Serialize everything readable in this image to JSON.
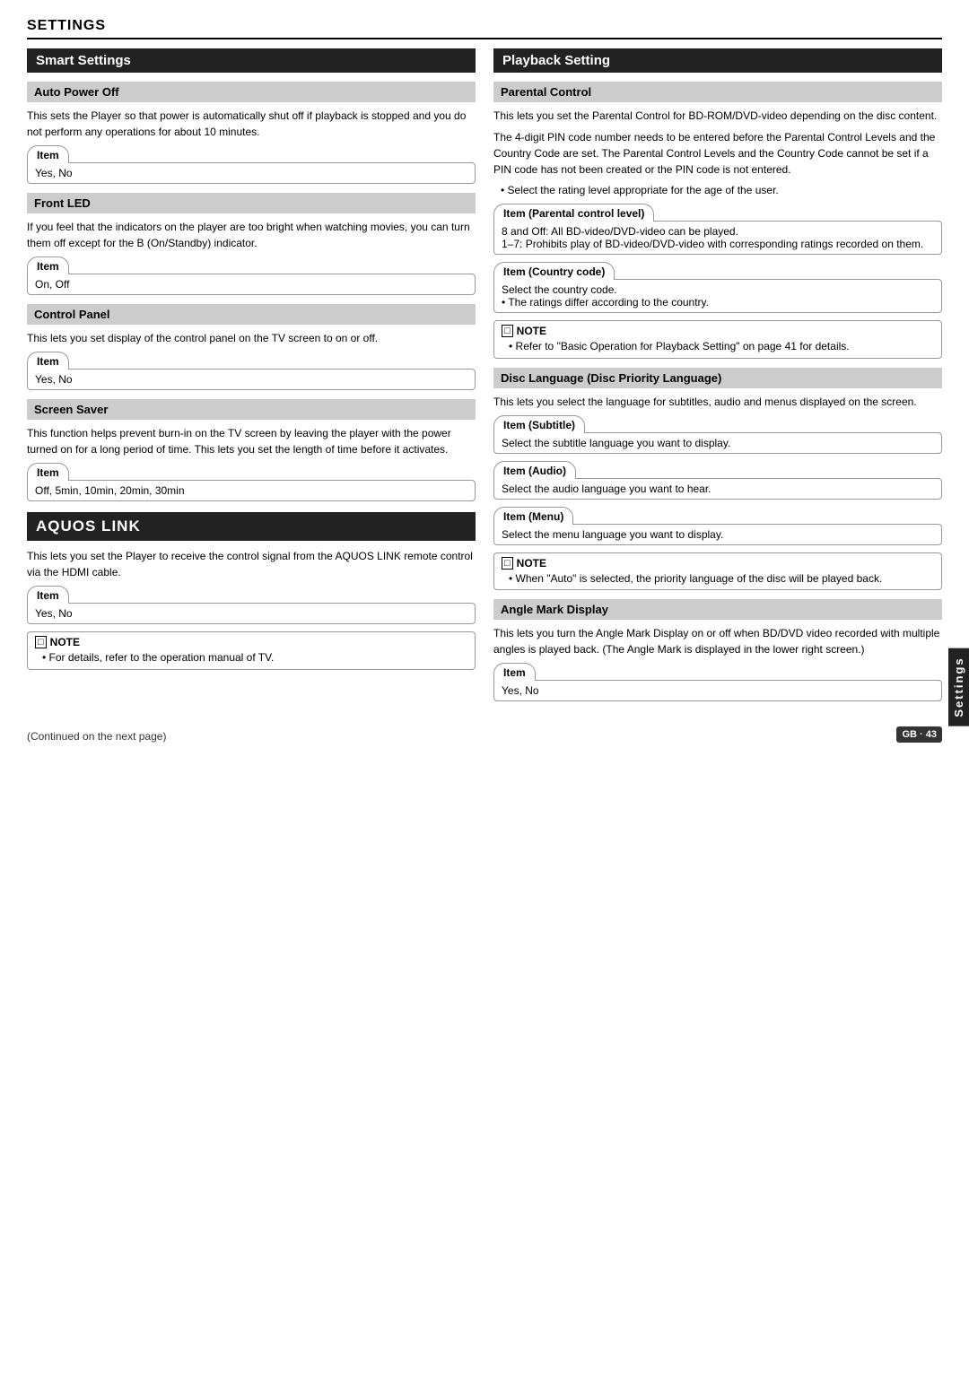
{
  "header": {
    "title": "SETTINGS"
  },
  "left_column": {
    "smart_settings": {
      "title": "Smart Settings",
      "sections": [
        {
          "id": "auto-power-off",
          "title": "Auto Power Off",
          "body": "This sets the Player so that power is automatically shut off if playback is stopped and you do not perform any operations for about 10 minutes.",
          "item_label": "Item",
          "item_value": "Yes, No"
        },
        {
          "id": "front-led",
          "title": "Front LED",
          "body": "If you feel that the indicators on the player are too bright when watching movies, you can turn them off except for the B    (On/Standby) indicator.",
          "item_label": "Item",
          "item_value": "On, Off"
        },
        {
          "id": "control-panel",
          "title": "Control Panel",
          "body": "This lets you set display of the control panel on the TV screen to on or off.",
          "item_label": "Item",
          "item_value": "Yes, No"
        },
        {
          "id": "screen-saver",
          "title": "Screen Saver",
          "body": "This function helps prevent burn-in on the TV screen by leaving the player with the power turned on for a long period of time. This lets you set the length of time before it activates.",
          "item_label": "Item",
          "item_value": "Off, 5min, 10min, 20min, 30min"
        }
      ]
    },
    "aquos_link": {
      "title": "AQUOS LINK",
      "body": "This lets you set the Player to receive the control signal from the AQUOS LINK remote control via the HDMI cable.",
      "item_label": "Item",
      "item_value": "Yes, No",
      "note_title": "NOTE",
      "note_bullet": "For details, refer to the operation manual of TV."
    }
  },
  "right_column": {
    "playback_setting": {
      "title": "Playback Setting",
      "sections": [
        {
          "id": "parental-control",
          "title": "Parental Control",
          "body1": "This lets you set the Parental Control for BD-ROM/DVD-video depending on the disc content.",
          "body2": "The 4-digit PIN code number needs to be entered before the Parental Control Levels and the Country Code are set. The Parental Control Levels and the Country Code cannot be set if a PIN code has not been created or the PIN code is not entered.",
          "bullet": "Select the rating level appropriate for the age of the user.",
          "items": [
            {
              "label": "Item (Parental control level)",
              "lines": [
                "8 and Off: All BD-video/DVD-video can be played.",
                "1–7: Prohibits play of BD-video/DVD-video with corresponding ratings recorded on them."
              ]
            },
            {
              "label": "Item (Country code)",
              "lines": [
                "Select the country code.",
                "• The ratings differ according to the country."
              ]
            }
          ],
          "note_title": "NOTE",
          "note_bullet": "Refer to \"Basic Operation for Playback Setting\" on page 41 for details."
        },
        {
          "id": "disc-language",
          "title": "Disc Language (Disc Priority Language)",
          "body": "This lets you select the language for subtitles, audio and menus displayed on the screen.",
          "items": [
            {
              "label": "Item (Subtitle)",
              "value": "Select the subtitle language you want to display."
            },
            {
              "label": "Item (Audio)",
              "value": "Select the audio language you want to hear."
            },
            {
              "label": "Item (Menu)",
              "value": "Select the menu language you want to display."
            }
          ],
          "note_title": "NOTE",
          "note_bullet": "When \"Auto\" is selected, the priority language of the disc will be played back."
        },
        {
          "id": "angle-mark-display",
          "title": "Angle Mark Display",
          "body": "This lets you turn the Angle Mark Display on or off when BD/DVD video recorded with multiple angles is played back. (The Angle Mark is displayed in the lower right screen.)",
          "item_label": "Item",
          "item_value": "Yes, No"
        }
      ]
    }
  },
  "footer": {
    "continued": "(Continued on the next page)",
    "page_badge": "GB · 43"
  },
  "sidebar_tab": "Settings"
}
